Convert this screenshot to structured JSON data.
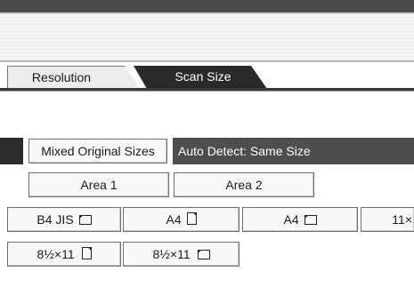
{
  "tabs": [
    {
      "label": "Resolution",
      "active": false
    },
    {
      "label": "Scan Size",
      "active": true
    }
  ],
  "mixed_original_sizes": {
    "label": "Mixed Original Sizes"
  },
  "status": {
    "text": "Auto Detect: Same Size"
  },
  "areas": [
    {
      "label": "Area 1"
    },
    {
      "label": "Area 2"
    }
  ],
  "sizes_row1": [
    {
      "label": "B4 JIS",
      "orientation": "landscape"
    },
    {
      "label": "A4",
      "orientation": "portrait"
    },
    {
      "label": "A4",
      "orientation": "landscape"
    },
    {
      "label": "11×",
      "orientation": ""
    }
  ],
  "sizes_row2": [
    {
      "label": "8½×11",
      "orientation": "portrait"
    },
    {
      "label": "8½×11",
      "orientation": "landscape"
    }
  ],
  "colors": {
    "active_tab_bg": "#2a2a2a",
    "status_bg": "#4e4e4e",
    "button_bg": "#f8f8f8"
  }
}
